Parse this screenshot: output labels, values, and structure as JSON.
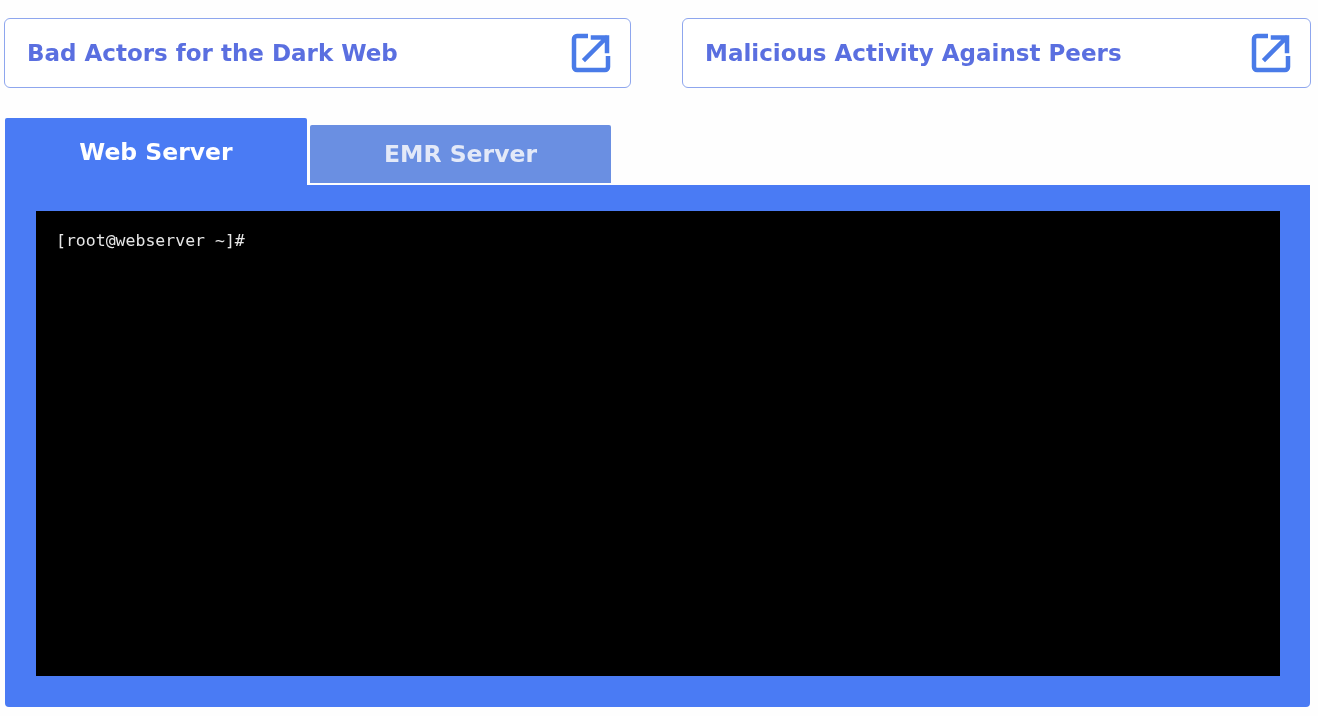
{
  "links": [
    {
      "label": "Bad Actors for the Dark Web"
    },
    {
      "label": "Malicious Activity Against Peers"
    }
  ],
  "tabs": [
    {
      "label": "Web Server",
      "selected": true
    },
    {
      "label": "EMR Server",
      "selected": false
    }
  ],
  "terminal": {
    "prompt": "[root@webserver ~]#"
  }
}
